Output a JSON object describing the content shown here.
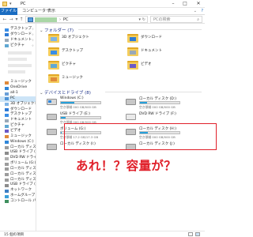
{
  "window": {
    "title": "PC"
  },
  "ribbon": {
    "tabs": [
      "ファイル",
      "コンピューター",
      "表示"
    ]
  },
  "address": {
    "path": "PC",
    "separator": "›",
    "search_placeholder": "PCの検索"
  },
  "sidebar": {
    "quick_access": [
      {
        "label": "デスクトップ",
        "icon": "desktop-icon"
      },
      {
        "label": "ダウンロード",
        "icon": "download-icon"
      },
      {
        "label": "ドキュメント",
        "icon": "document-icon"
      },
      {
        "label": "ピクチャ",
        "icon": "picture-icon"
      }
    ],
    "mid": [
      {
        "label": "ミュージック",
        "icon": "music-icon"
      },
      {
        "label": "OneDrive",
        "icon": "cloud-icon"
      },
      {
        "label": "all-1",
        "icon": "user-icon"
      },
      {
        "label": "PC",
        "icon": "pc-icon",
        "selected": true
      }
    ],
    "pc_children": [
      {
        "label": "3D オブジェクト",
        "icon": "3d-objects-icon"
      },
      {
        "label": "ダウンロード",
        "icon": "download-icon"
      },
      {
        "label": "デスクトップ",
        "icon": "desktop-icon"
      },
      {
        "label": "ドキュメント",
        "icon": "document-icon"
      },
      {
        "label": "ピクチャ",
        "icon": "picture-icon"
      },
      {
        "label": "ビデオ",
        "icon": "video-icon"
      },
      {
        "label": "ミュージック",
        "icon": "music-icon"
      },
      {
        "label": "Windows (C:)",
        "icon": "windows-drive-icon"
      },
      {
        "label": "ローカル ディスク (D:)",
        "icon": "drive-icon"
      },
      {
        "label": "USB ドライブ (E:)",
        "icon": "usb-drive-icon"
      },
      {
        "label": "DVD RW ドライブ (F:)",
        "icon": "dvd-drive-icon"
      },
      {
        "label": "ボリューム (G:)",
        "icon": "drive-icon"
      },
      {
        "label": "ローカル ディスク (H:)",
        "icon": "drive-icon"
      },
      {
        "label": "ローカル ディスク (I:)",
        "icon": "drive-icon"
      },
      {
        "label": "ローカル ディスク (J:)",
        "icon": "drive-icon"
      },
      {
        "label": "USB ドライブ (E:)",
        "icon": "usb-drive-icon"
      },
      {
        "label": "ネットワーク",
        "icon": "network-icon"
      },
      {
        "label": "ホームグループ",
        "icon": "homegroup-icon"
      },
      {
        "label": "コントロール パネル",
        "icon": "control-panel-icon"
      }
    ]
  },
  "main": {
    "folders_header": "フォルダー (7)",
    "folders": [
      {
        "label": "3D オブジェクト",
        "icon": "3d-objects-icon"
      },
      {
        "label": "ダウンロード",
        "icon": "download-icon"
      },
      {
        "label": "デスクトップ",
        "icon": "desktop-icon"
      },
      {
        "label": "ドキュメント",
        "icon": "document-icon"
      },
      {
        "label": "ピクチャ",
        "icon": "picture-icon"
      },
      {
        "label": "ビデオ",
        "icon": "video-icon"
      },
      {
        "label": "ミュージック",
        "icon": "music-icon"
      }
    ],
    "drives_header": "デバイスとドライブ (8)",
    "drives": [
      {
        "label": "Windows (C:)",
        "free": "空き領域 000 GB/000 GB",
        "usage": 0.34,
        "icon": "windows-drive-icon"
      },
      {
        "label": "ローカル ディスク (D:)",
        "free": "空き領域 000 GB/000 GB",
        "usage": 0.18,
        "icon": "drive-icon"
      },
      {
        "label": "USB ドライブ (E:)",
        "free": "空き領域 000 GB/000 GB",
        "usage": 0.12,
        "icon": "usb-drive-icon"
      },
      {
        "label": "DVD RW ドライブ (F:)",
        "free": "",
        "usage": null,
        "icon": "dvd-drive-icon"
      },
      {
        "label": "ボリューム (G:)",
        "free": "空き領域 17.2 GB/17.3 GB",
        "usage": 0.02,
        "icon": "drive-icon"
      },
      {
        "label": "ローカル ディスク (H:)",
        "free": "空き領域 000 GB/000 GB",
        "usage": 0.2,
        "icon": "drive-icon"
      },
      {
        "label": "ローカル ディスク (I:)",
        "free": "",
        "usage": null,
        "icon": "drive-icon"
      },
      {
        "label": "ローカル ディスク (J:)",
        "free": "",
        "usage": null,
        "icon": "drive-icon"
      }
    ]
  },
  "annotation": "あれ！？容量が？",
  "status": {
    "items": "15 個の項目"
  },
  "colors": {
    "accent": "#1a6cc1",
    "annotation": "#e0202a",
    "folder": "#f4cd5d",
    "bar": "#26a0da"
  }
}
